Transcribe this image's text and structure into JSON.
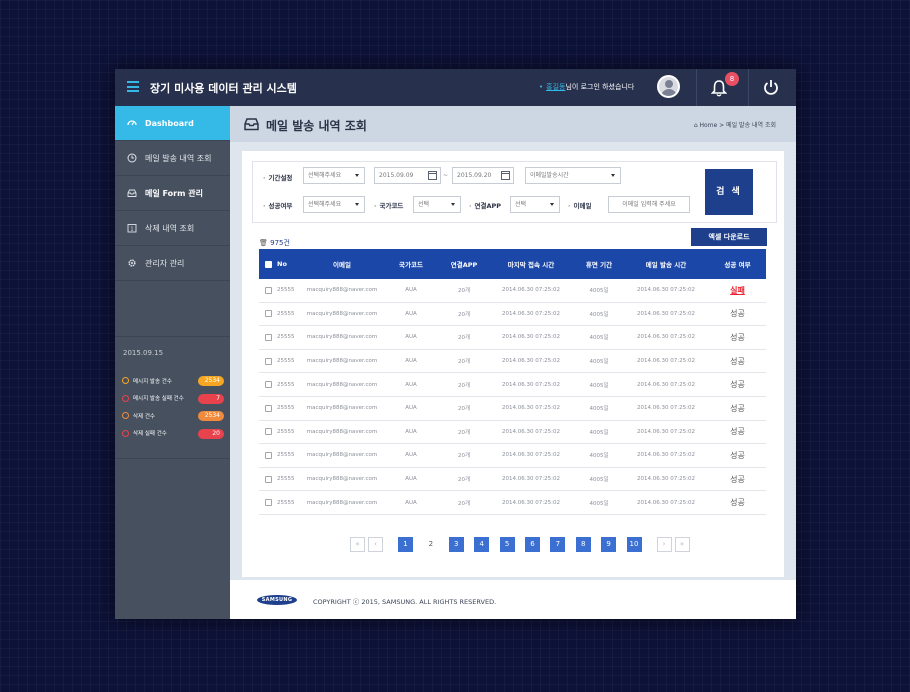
{
  "app": {
    "title": "장기 미사용 데이터 관리 시스템",
    "login": {
      "bullet": "•",
      "user": "홍길동",
      "suffix": "님이 로그인 하셨습니다"
    },
    "notification_count": "8"
  },
  "sidebar": {
    "items": [
      {
        "label": "Dashboard",
        "icon": "dashboard-icon"
      },
      {
        "label": "메일 발송 내역 조회",
        "icon": "clock-icon"
      },
      {
        "label": "메일 Form 관리",
        "icon": "inbox-icon"
      },
      {
        "label": "삭제 내역 조회",
        "icon": "calendar-icon"
      },
      {
        "label": "관리자 관리",
        "icon": "gear-icon"
      }
    ],
    "date": "2015.09.15",
    "stats": [
      {
        "label": "메시지 발송 건수",
        "value": "2534",
        "color": "#f5a623"
      },
      {
        "label": "메시지 발송 실패 건수",
        "value": "7",
        "color": "#e8434d"
      },
      {
        "label": "삭제 건수",
        "value": "2534",
        "color": "#f08a3c"
      },
      {
        "label": "삭제 실패 건수",
        "value": "20",
        "color": "#e8434d"
      }
    ]
  },
  "page": {
    "title": "메일 발송 내역 조회",
    "breadcrumb": "Home > 메일 발송 내역 조회"
  },
  "filters": {
    "period_label": "기간설정",
    "period_select": "선택해주세요",
    "date_from": "2015.09.09",
    "tilde": "~",
    "date_to": "2015.09.20",
    "time_select": "이메일발송시간",
    "success_label": "성공여부",
    "success_select": "선택해주세요",
    "country_label": "국가코드",
    "country_select": "선택",
    "app_label": "연결APP",
    "app_select": "선택",
    "email_label": "이메일",
    "email_placeholder": "이메일 입력해 주세요",
    "search_button": "검 색"
  },
  "results": {
    "count": "975건",
    "excel_button": "엑셀 다운로드"
  },
  "table": {
    "headers": [
      "No",
      "이메일",
      "국가코드",
      "연결APP",
      "마지막 접속 시간",
      "휴면 기간",
      "메일 발송 시간",
      "성공 여부"
    ],
    "rows": [
      {
        "no": "25555",
        "email": "macquiry888@naver.com",
        "country": "AUA",
        "app": "20개",
        "last": "2014.06.30 07:25:02",
        "dormant": "4005일",
        "sent": "2014.06.30 07:25:02",
        "result": "실패"
      },
      {
        "no": "25555",
        "email": "macquiry888@naver.com",
        "country": "AUA",
        "app": "20개",
        "last": "2014.06.30 07:25:02",
        "dormant": "4005일",
        "sent": "2014.06.30 07:25:02",
        "result": "성공"
      },
      {
        "no": "25555",
        "email": "macquiry888@naver.com",
        "country": "AUA",
        "app": "20개",
        "last": "2014.06.30 07:25:02",
        "dormant": "4005일",
        "sent": "2014.06.30 07:25:02",
        "result": "성공"
      },
      {
        "no": "25555",
        "email": "macquiry888@naver.com",
        "country": "AUA",
        "app": "20개",
        "last": "2014.06.30 07:25:02",
        "dormant": "4005일",
        "sent": "2014.06.30 07:25:02",
        "result": "성공"
      },
      {
        "no": "25555",
        "email": "macquiry888@naver.com",
        "country": "AUA",
        "app": "20개",
        "last": "2014.06.30 07:25:02",
        "dormant": "4005일",
        "sent": "2014.06.30 07:25:02",
        "result": "성공"
      },
      {
        "no": "25555",
        "email": "macquiry888@naver.com",
        "country": "AUA",
        "app": "20개",
        "last": "2014.06.30 07:25:02",
        "dormant": "4005일",
        "sent": "2014.06.30 07:25:02",
        "result": "성공"
      },
      {
        "no": "25555",
        "email": "macquiry888@naver.com",
        "country": "AUA",
        "app": "20개",
        "last": "2014.06.30 07:25:02",
        "dormant": "4005일",
        "sent": "2014.06.30 07:25:02",
        "result": "성공"
      },
      {
        "no": "25555",
        "email": "macquiry888@naver.com",
        "country": "AUA",
        "app": "20개",
        "last": "2014.06.30 07:25:02",
        "dormant": "4005일",
        "sent": "2014.06.30 07:25:02",
        "result": "성공"
      },
      {
        "no": "25555",
        "email": "macquiry888@naver.com",
        "country": "AUA",
        "app": "20개",
        "last": "2014.06.30 07:25:02",
        "dormant": "4005일",
        "sent": "2014.06.30 07:25:02",
        "result": "성공"
      },
      {
        "no": "25555",
        "email": "macquiry888@naver.com",
        "country": "AUA",
        "app": "20개",
        "last": "2014.06.30 07:25:02",
        "dormant": "4005일",
        "sent": "2014.06.30 07:25:02",
        "result": "성공"
      }
    ]
  },
  "pagination": {
    "first": "«",
    "prev": "‹",
    "next": "›",
    "last": "»",
    "pages": [
      "1",
      "2",
      "3",
      "4",
      "5",
      "6",
      "7",
      "8",
      "9",
      "10"
    ],
    "current": "2"
  },
  "footer": {
    "logo": "SAMSUNG",
    "copyright": "COPYRIGHT ⓒ 2015, SAMSUNG. ALL RIGHTS RESERVED."
  }
}
